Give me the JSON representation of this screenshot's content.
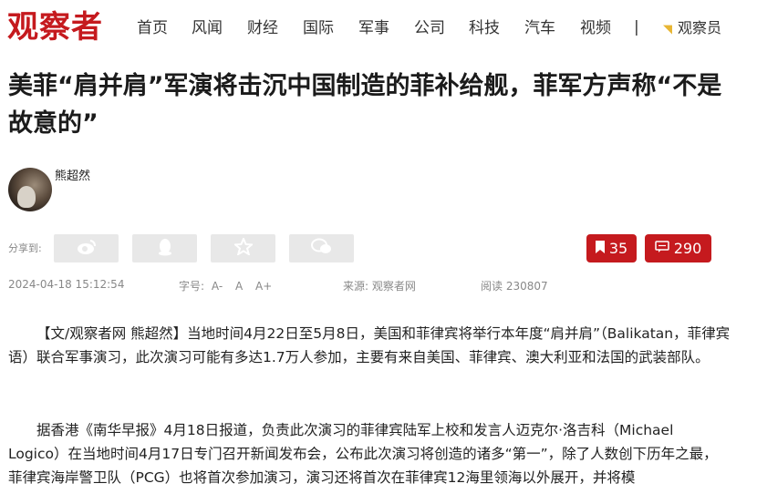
{
  "site": {
    "logo": "观察者"
  },
  "nav": {
    "items": [
      "首页",
      "风闻",
      "财经",
      "国际",
      "军事",
      "公司",
      "科技",
      "汽车",
      "视频"
    ],
    "separator": "|",
    "observer_label": "观察员"
  },
  "article": {
    "title": "美菲“肩并肩”军演将击沉中国制造的菲补给舰，菲军方声称“不是故意的”",
    "author": "熊超然",
    "share_label": "分享到:",
    "bookmark_count": "35",
    "comment_count": "290",
    "date": "2024-04-18 15:12:54",
    "font_size_label": "字号:",
    "font_sizes": [
      "A-",
      "A",
      "A+"
    ],
    "source_label": "来源:",
    "source": "观察者网",
    "read_label": "阅读",
    "read_count": "230807",
    "paragraphs": [
      "【文/观察者网 熊超然】当地时间4月22日至5月8日，美国和菲律宾将举行本年度“肩并肩”（Balikatan，菲律宾语）联合军事演习，此次演习可能有多达1.7万人参加，主要有来自美国、菲律宾、澳大利亚和法国的武装部队。",
      "据香港《南华早报》4月18日报道，负责此次演习的菲律宾陆军上校和发言人迈克尔·洛吉科（Michael Logico）在当地时间4月17日专门召开新闻发布会，公布此次演习将创造的诸多“第一”，除了人数创下历年之最，菲律宾海岸警卫队（PCG）也将首次参加演习，演习还将首次在菲律宾12海里领海以外展开，并将模"
    ]
  },
  "colors": {
    "brand_red": "#c51a1e",
    "share_grey": "#e8e8e8",
    "meta_grey": "#888888"
  },
  "icons": {
    "share": [
      "weibo-icon",
      "qq-icon",
      "qzone-star-icon",
      "wechat-icon"
    ],
    "bookmark": "bookmark-icon",
    "comment": "comment-icon"
  }
}
